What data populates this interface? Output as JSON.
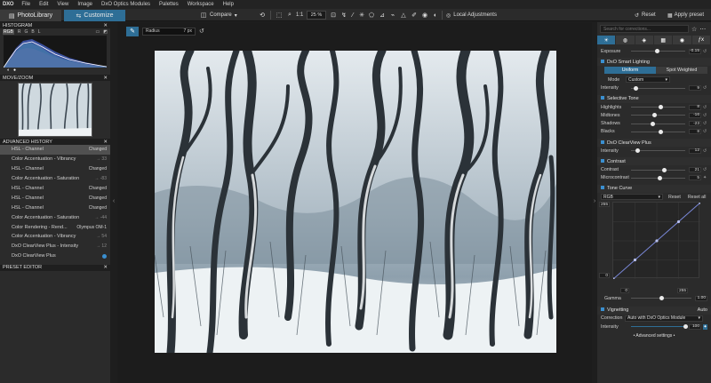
{
  "menubar": {
    "logo": "DXO",
    "items": [
      "File",
      "Edit",
      "View",
      "Image",
      "DxO Optics Modules",
      "Palettes",
      "Workspace",
      "Help"
    ]
  },
  "toolbar": {
    "tabs": [
      {
        "label": "PhotoLibrary",
        "active": false
      },
      {
        "label": "Customize",
        "active": true
      }
    ],
    "compare_label": "Compare",
    "zoom_fit": "1:1",
    "zoom_value": "25 %",
    "local_adjustments": "Local Adjustments",
    "reset_label": "Reset",
    "apply_preset_label": "Apply preset"
  },
  "left": {
    "histogram_title": "HISTOGRAM",
    "channels": [
      "RGB",
      "R",
      "G",
      "B",
      "L"
    ],
    "movezoom_title": "MOVE/ZOOM",
    "history_title": "ADVANCED HISTORY",
    "history": [
      {
        "label": "HSL - Channel",
        "value": "Changed",
        "selected": true
      },
      {
        "label": "Color Accentuation - Vibrancy",
        "value": "→ 33"
      },
      {
        "label": "HSL - Channel",
        "value": "Changed"
      },
      {
        "label": "Color Accentuation - Saturation",
        "value": "→ -83"
      },
      {
        "label": "HSL - Channel",
        "value": "Changed"
      },
      {
        "label": "HSL - Channel",
        "value": "Changed"
      },
      {
        "label": "HSL - Channel",
        "value": "Changed"
      },
      {
        "label": "Color Accentuation - Saturation",
        "value": "→ -44"
      },
      {
        "label": "Color Rendering - Rend...",
        "value": "Olympus OM-1"
      },
      {
        "label": "Color Accentuation - Vibrancy",
        "value": "→ 54"
      },
      {
        "label": "DxO ClearView Plus - Intensity",
        "value": "→ 12"
      },
      {
        "label": "DxO ClearView Plus",
        "value": ""
      }
    ],
    "preset_editor_title": "PRESET EDITOR"
  },
  "viewer": {
    "radius_label": "Radius",
    "radius_value": "7 px"
  },
  "right": {
    "search_placeholder": "Search for corrections...",
    "exposure": {
      "label": "Exposure",
      "value": "-0.15",
      "level": 0.47
    },
    "smart_lighting": {
      "title": "DxO Smart Lighting",
      "modes": [
        "Uniform",
        "Spot Weighted"
      ],
      "mode_label": "Mode",
      "mode_value": "Custom",
      "intensity_label": "Intensity",
      "intensity_value": "9",
      "intensity_level": 0.09
    },
    "selective_tone": {
      "title": "Selective Tone",
      "rows": [
        {
          "label": "Highlights",
          "value": "8",
          "level": 0.54
        },
        {
          "label": "Midtones",
          "value": "-16",
          "level": 0.42
        },
        {
          "label": "Shadows",
          "value": "-23",
          "level": 0.39
        },
        {
          "label": "Blacks",
          "value": "8",
          "level": 0.54
        }
      ]
    },
    "clearview": {
      "title": "DxO ClearView Plus",
      "label": "Intensity",
      "value": "12",
      "level": 0.12
    },
    "contrast": {
      "title": "Contrast",
      "rows": [
        {
          "label": "Contrast",
          "value": "21",
          "level": 0.6
        },
        {
          "label": "Microcontrast",
          "value": "5",
          "level": 0.52
        }
      ]
    },
    "tone_curve": {
      "title": "Tone Curve",
      "channel": "RGB",
      "reset_label": "Reset",
      "reset_all_label": "Reset all",
      "top_value": "255",
      "left_value": "0",
      "bottom_left": "0",
      "bottom_right": "255",
      "gamma_label": "Gamma",
      "gamma_value": "1.00"
    },
    "vignetting": {
      "title": "Vignetting",
      "auto_label": "Auto",
      "correction_label": "Correction",
      "correction_value": "Auto with DxO Optics Module",
      "intensity_label": "Intensity",
      "intensity_value": "100",
      "intensity_level": 1.0,
      "advanced_label": "• Advanced settings •"
    }
  },
  "colors": {
    "accent": "#2e6e96",
    "panel": "#2b2b2b",
    "bg": "#1c1c1c"
  }
}
